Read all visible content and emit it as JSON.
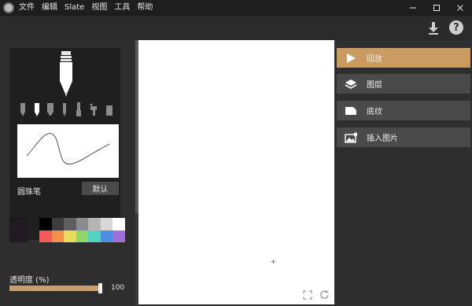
{
  "menu": {
    "items": [
      "文件",
      "编辑",
      "Slate",
      "视图",
      "工具",
      "帮助"
    ]
  },
  "toolbar": {
    "download_icon": "download-icon",
    "help_label": "?"
  },
  "brush": {
    "name": "圆珠笔",
    "default_label": "默认",
    "tools": [
      "pen",
      "ballpoint",
      "marker",
      "pencil",
      "brush",
      "airbrush",
      "eraser"
    ]
  },
  "colors": {
    "current": "#211a22",
    "palette": [
      "#000000",
      "#3c3c3c",
      "#5e5e5e",
      "#8c8c8c",
      "#b4b4b4",
      "#d7d7d7",
      "#ffffff",
      "#f45a5a",
      "#f2904a",
      "#e8dc5a",
      "#8fd76a",
      "#4fd6c2",
      "#4a8ee6",
      "#a070d8"
    ]
  },
  "opacity": {
    "label": "透明度 (%)",
    "value": "100",
    "fraction": 1.0
  },
  "panel": {
    "items": [
      {
        "label": "回放",
        "icon": "play-icon",
        "active": true
      },
      {
        "label": "图层",
        "icon": "layers-icon",
        "active": false
      },
      {
        "label": "底纹",
        "icon": "paper-icon",
        "active": false
      },
      {
        "label": "插入图片",
        "icon": "insert-image-icon",
        "active": false
      }
    ]
  },
  "canvas": {
    "cursor_glyph": "+"
  },
  "accent": "#c99a62"
}
